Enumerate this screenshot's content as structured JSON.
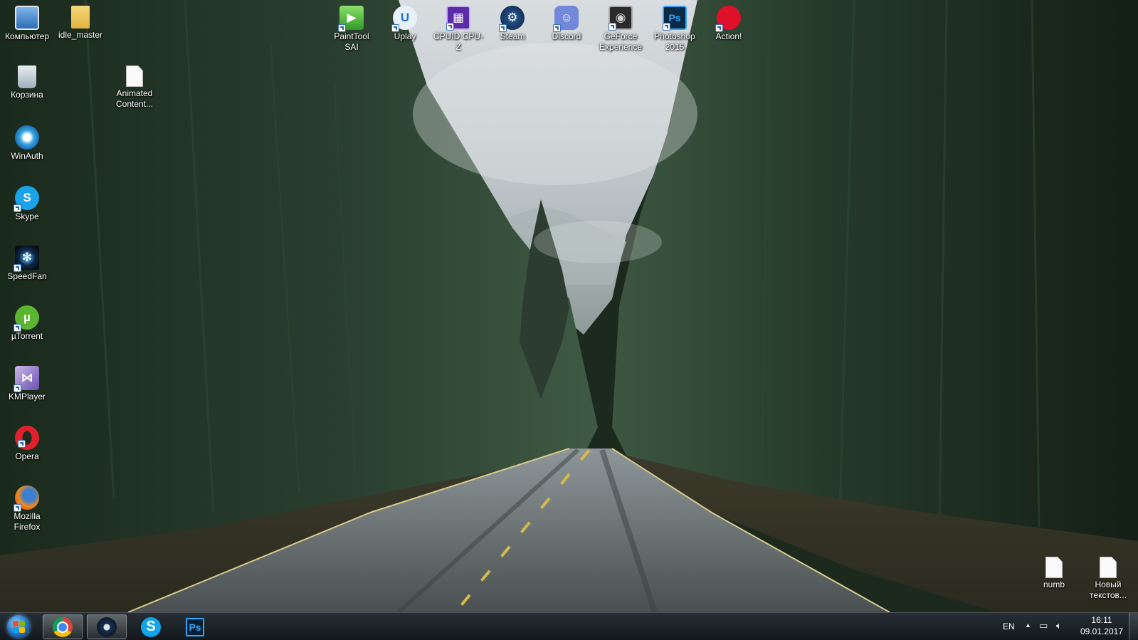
{
  "desktop": {
    "left_icons": [
      {
        "label": "Компьютер",
        "icon": "computer-icon"
      },
      {
        "label": "Корзина",
        "icon": "recycle-bin-icon"
      },
      {
        "label": "WinAuth",
        "icon": "winauth-icon"
      },
      {
        "label": "Skype",
        "icon": "skype-icon"
      },
      {
        "label": "SpeedFan",
        "icon": "speedfan-icon"
      },
      {
        "label": "µTorrent",
        "icon": "utorrent-icon"
      },
      {
        "label": "KMPlayer",
        "icon": "kmplayer-icon"
      },
      {
        "label": "Opera",
        "icon": "opera-icon"
      },
      {
        "label": "Mozilla Firefox",
        "icon": "firefox-icon"
      }
    ],
    "second_column": [
      {
        "label": "idle_master",
        "icon": "folder-icon"
      },
      {
        "label": "Animated Content...",
        "icon": "file-icon"
      }
    ],
    "top_row": [
      {
        "label": "PaintTool SAI",
        "icon": "painttool-sai-icon"
      },
      {
        "label": "Uplay",
        "icon": "uplay-icon"
      },
      {
        "label": "CPUID CPU-Z",
        "icon": "cpuz-icon"
      },
      {
        "label": "Steam",
        "icon": "steam-icon"
      },
      {
        "label": "Discord",
        "icon": "discord-icon"
      },
      {
        "label": "GeForce Experience",
        "icon": "geforce-icon"
      },
      {
        "label": "Photoshop 2015",
        "icon": "photoshop-icon"
      },
      {
        "label": "Action!",
        "icon": "action-icon"
      }
    ],
    "bottom_right": [
      {
        "label": "numb",
        "icon": "text-file-icon"
      },
      {
        "label": "Новый текстов...",
        "icon": "text-file-icon"
      }
    ]
  },
  "taskbar": {
    "pinned": [
      {
        "name": "chrome",
        "icon": "chrome-icon"
      },
      {
        "name": "steam",
        "icon": "steam-icon"
      },
      {
        "name": "skype",
        "icon": "skype-icon",
        "glyph": "S"
      },
      {
        "name": "photoshop",
        "icon": "photoshop-icon",
        "glyph": "Ps"
      }
    ],
    "tray": {
      "language": "EN",
      "time": "16:11",
      "date": "09.01.2017"
    }
  }
}
